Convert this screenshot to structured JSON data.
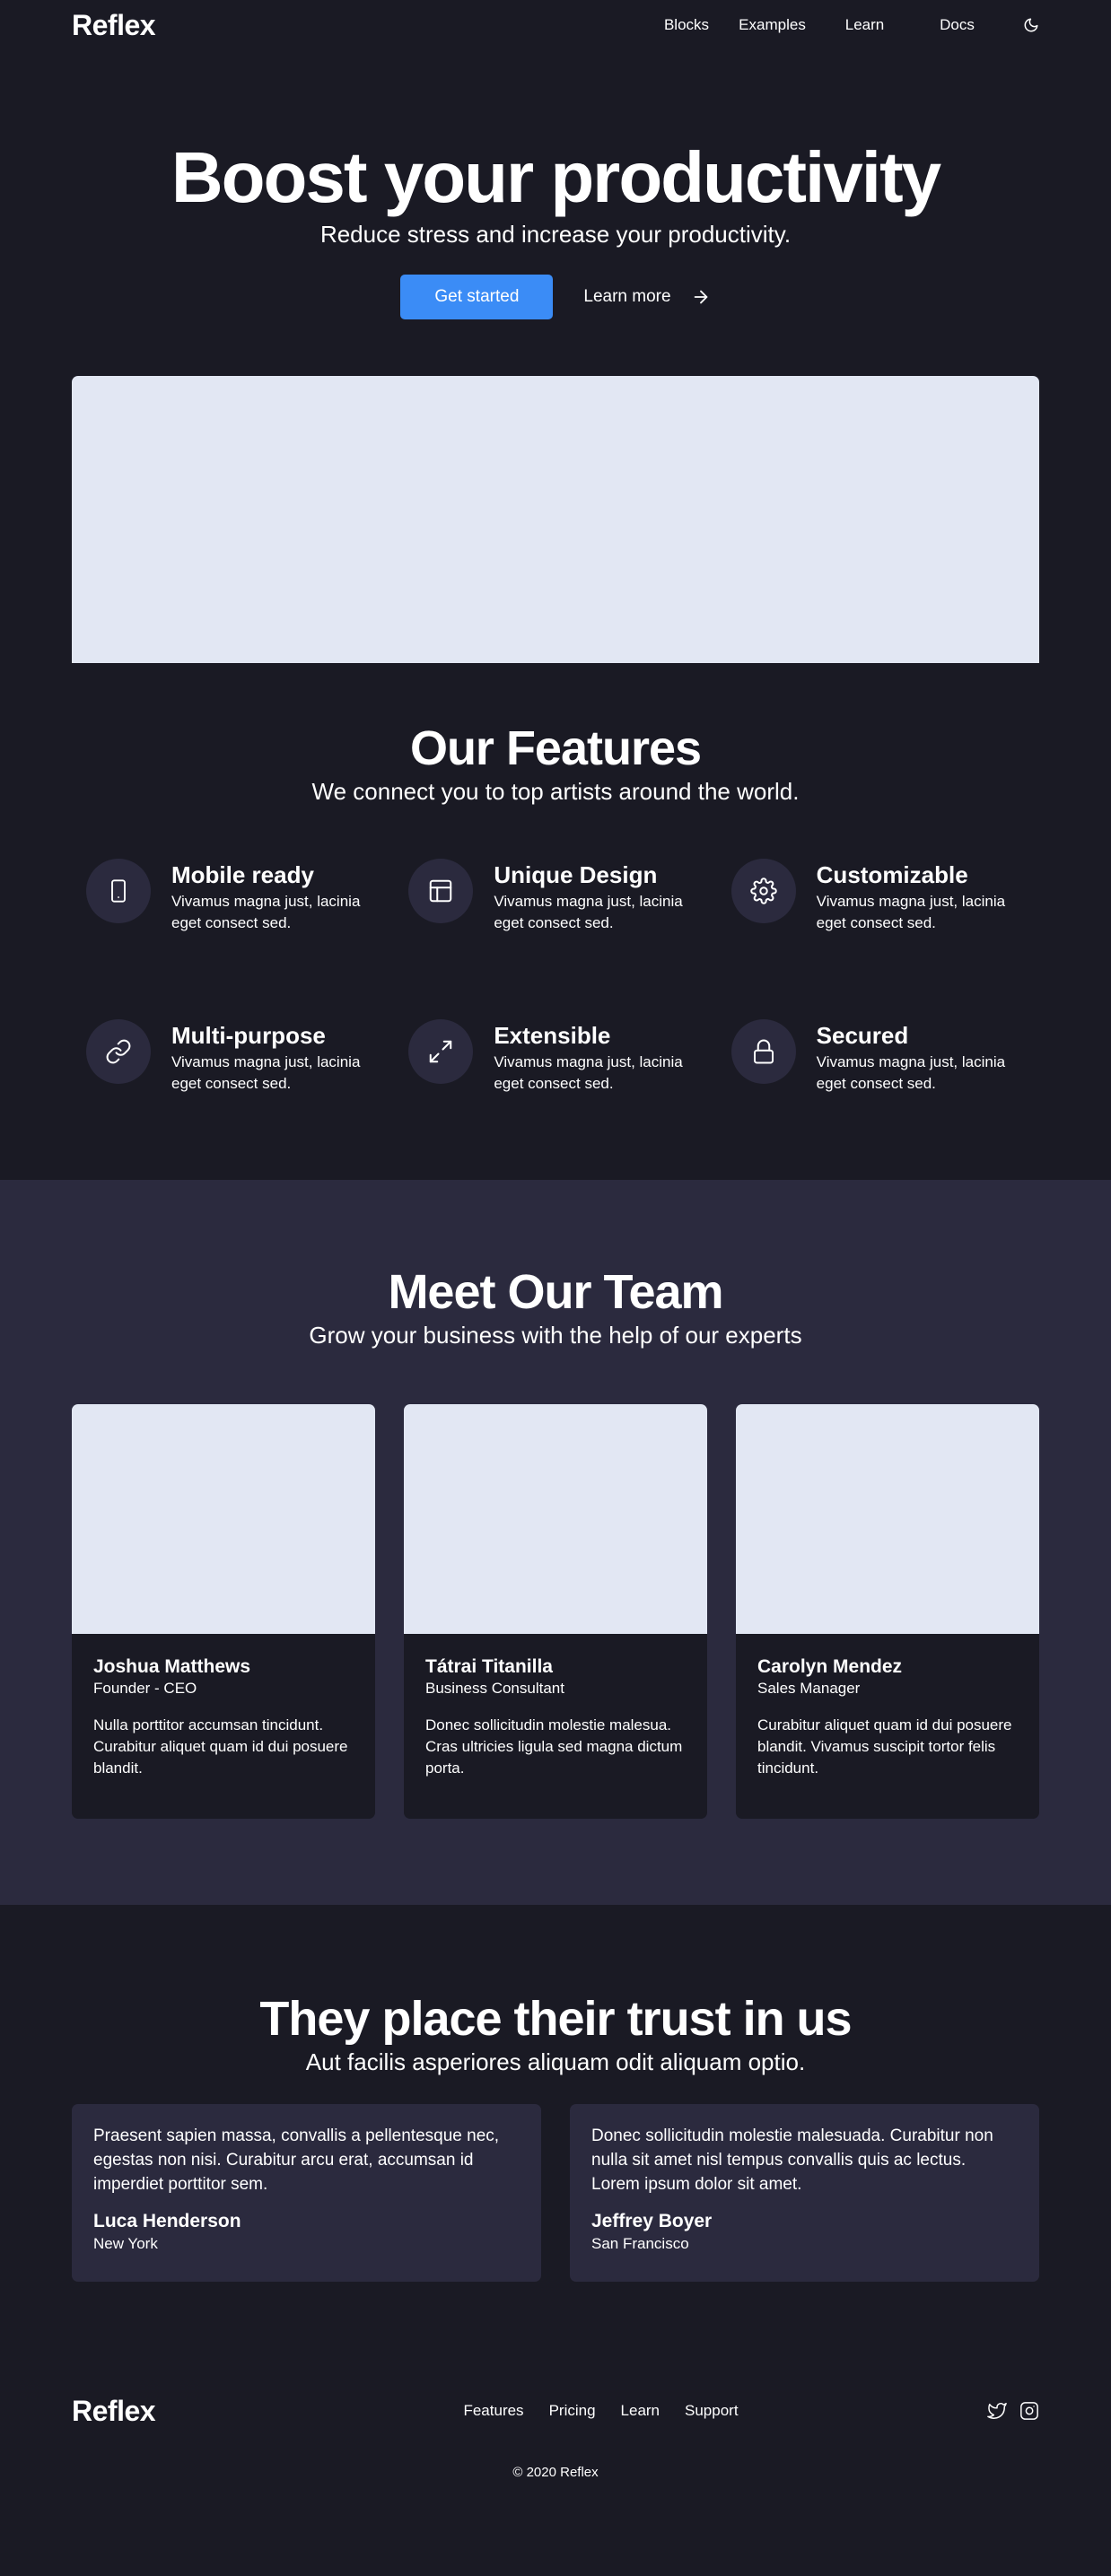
{
  "nav": {
    "logo": "Reflex",
    "links": [
      "Blocks",
      "Examples",
      "Learn",
      "Docs"
    ],
    "theme_icon": "moon-icon"
  },
  "hero": {
    "title": "Boost your productivity",
    "subtitle": "Reduce stress and increase your productivity.",
    "primary_button": "Get started",
    "secondary_button": "Learn more"
  },
  "features": {
    "title": "Our Features",
    "subtitle": "We connect you to top artists around the world.",
    "items": [
      {
        "title": "Mobile ready",
        "text": "Vivamus magna just, lacinia eget consect sed.",
        "icon": "mobile-icon"
      },
      {
        "title": "Unique Design",
        "text": "Vivamus magna just, lacinia eget consect sed.",
        "icon": "layout-icon"
      },
      {
        "title": "Customizable",
        "text": "Vivamus magna just, lacinia eget consect sed.",
        "icon": "gear-icon"
      },
      {
        "title": "Multi-purpose",
        "text": "Vivamus magna just, lacinia eget consect sed.",
        "icon": "link-icon"
      },
      {
        "title": "Extensible",
        "text": "Vivamus magna just, lacinia eget consect sed.",
        "icon": "expand-icon"
      },
      {
        "title": "Secured",
        "text": "Vivamus magna just, lacinia eget consect sed.",
        "icon": "lock-icon"
      }
    ]
  },
  "team": {
    "title": "Meet Our Team",
    "subtitle": "Grow your business with the help of our experts",
    "members": [
      {
        "name": "Joshua Matthews",
        "role": "Founder - CEO",
        "bio": "Nulla porttitor accumsan tincidunt. Curabitur aliquet quam id dui posuere blandit."
      },
      {
        "name": "Tátrai Titanilla",
        "role": "Business Consultant",
        "bio": "Donec sollicitudin molestie malesua. Cras ultricies ligula sed magna dictum porta."
      },
      {
        "name": "Carolyn Mendez",
        "role": "Sales Manager",
        "bio": "Curabitur aliquet quam id dui posuere blandit. Vivamus suscipit tortor felis tincidunt."
      }
    ]
  },
  "trust": {
    "title": "They place their trust in us",
    "subtitle": "Aut facilis asperiores aliquam odit aliquam optio.",
    "testimonials": [
      {
        "quote": "Praesent sapien massa, convallis a pellentesque nec, egestas non nisi. Curabitur arcu erat, accumsan id imperdiet porttitor sem.",
        "name": "Luca Henderson",
        "city": "New York"
      },
      {
        "quote": "Donec sollicitudin molestie malesuada. Curabitur non nulla sit amet nisl tempus convallis quis ac lectus. Lorem ipsum dolor sit amet.",
        "name": "Jeffrey Boyer",
        "city": "San Francisco"
      }
    ]
  },
  "footer": {
    "logo": "Reflex",
    "links": [
      "Features",
      "Pricing",
      "Learn",
      "Support"
    ],
    "social_icons": [
      "twitter-icon",
      "instagram-icon"
    ],
    "copyright": "© 2020 Reflex"
  },
  "colors": {
    "background": "#1a1a24",
    "surface": "#2b2a3e",
    "accent": "#3b8cf6",
    "placeholder": "#e2e7f3"
  }
}
